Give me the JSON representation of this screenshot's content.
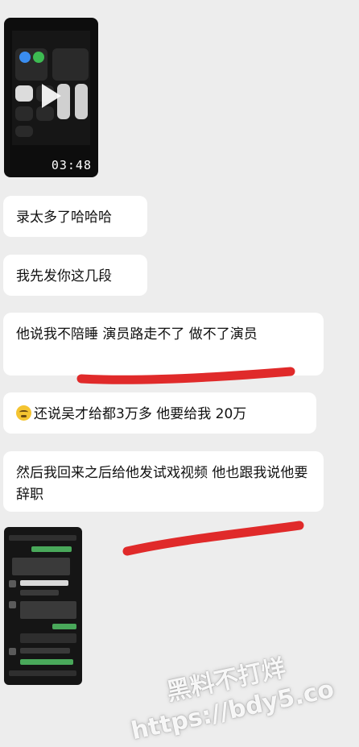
{
  "video_message": {
    "duration": "03:48",
    "icon": "play-icon"
  },
  "messages": [
    {
      "text": "录太多了哈哈哈"
    },
    {
      "text": "我先发你这几段"
    },
    {
      "text": "他说我不陪睡 演员路走不了 做不了演员"
    },
    {
      "emoji": "crying-face-emoji",
      "text": "还说吴才给都3万多 他要给我 20万"
    },
    {
      "text": "然后我回来之后给他发试戏视频 他也跟我说他要辞职"
    }
  ],
  "annotation_color": "#e02a2a",
  "watermark": {
    "line1": "黑料不打烊",
    "line2": "https://bdy5.co"
  }
}
